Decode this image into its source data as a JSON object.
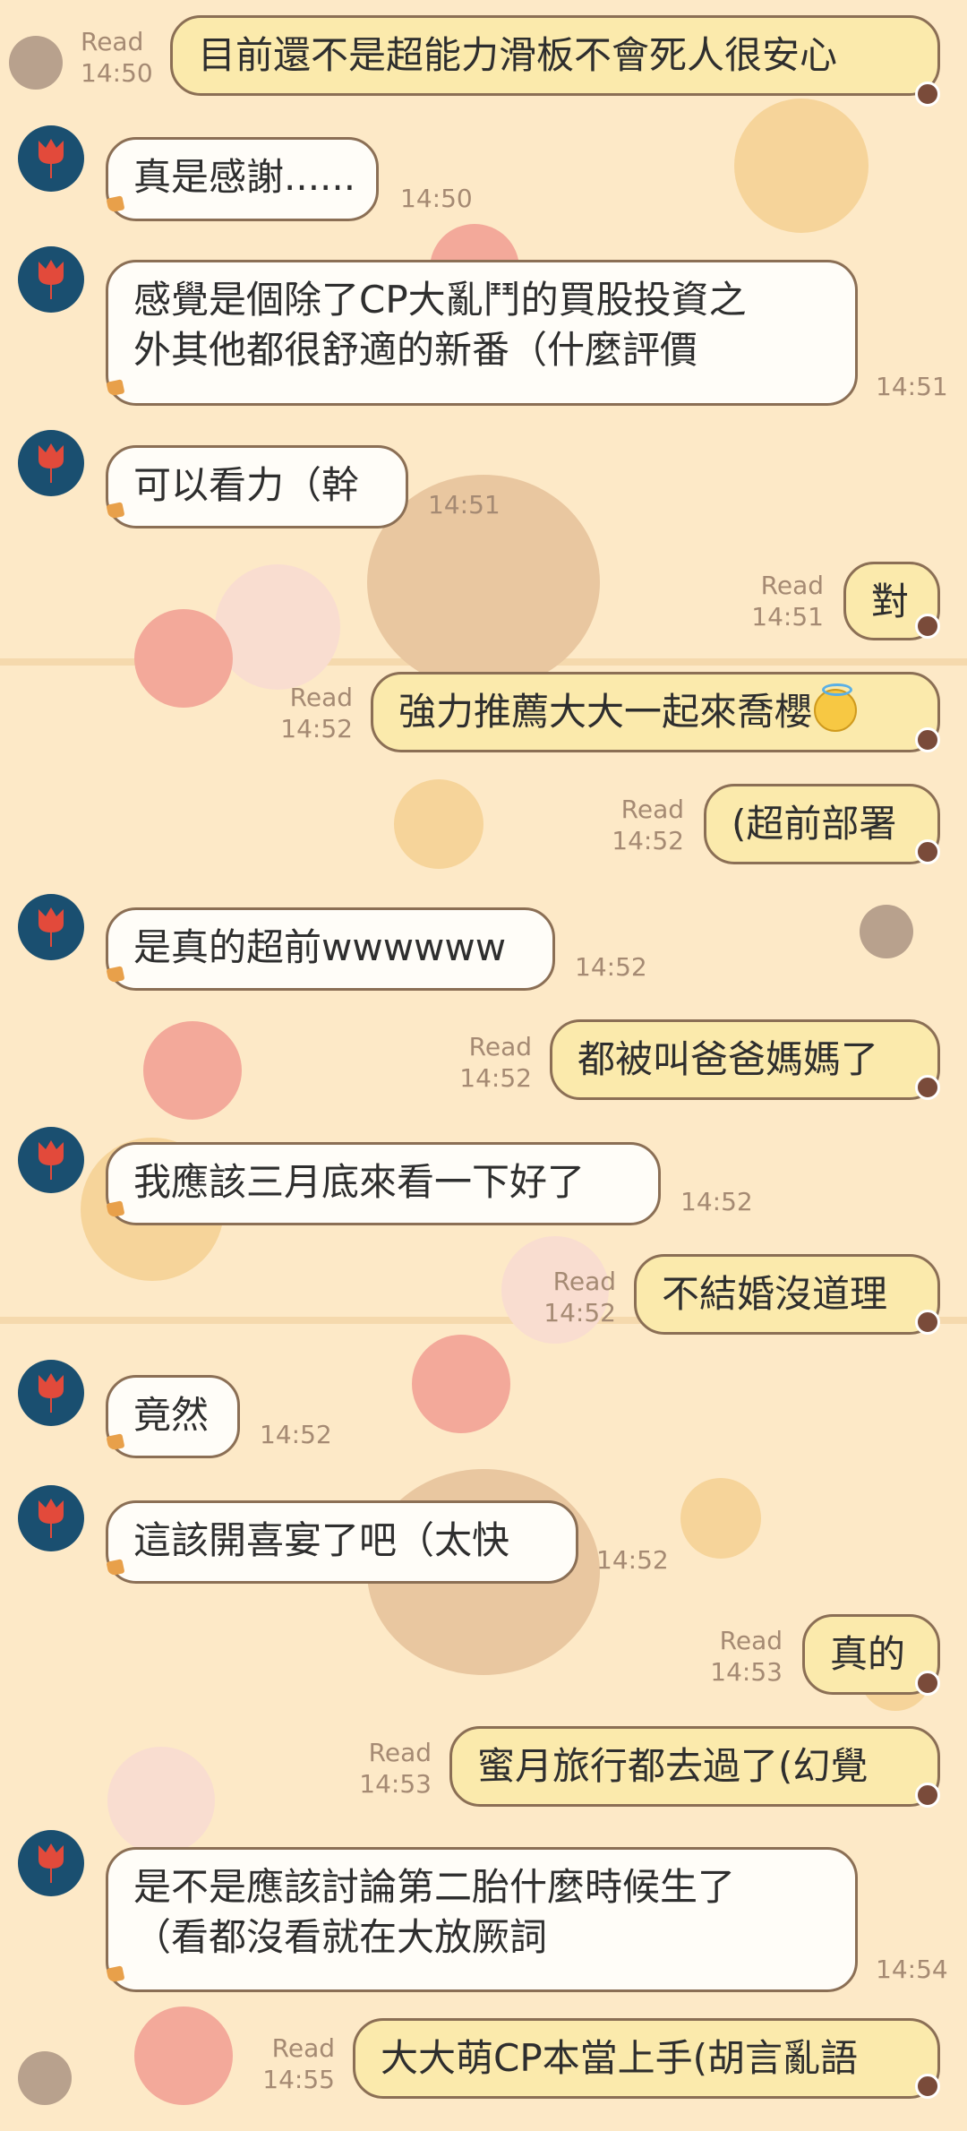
{
  "chat": {
    "messages": [
      {
        "side": "me",
        "text": "目前還不是超能力滑板不會死人很安心",
        "read": "Read",
        "time": "14:50"
      },
      {
        "side": "friend",
        "text": "真是感謝......",
        "time": "14:50"
      },
      {
        "side": "friend",
        "lines": [
          "感覺是個除了CP大亂鬥的買股投資之",
          "外其他都很舒適的新番（什麼評價"
        ],
        "time": "14:51"
      },
      {
        "side": "friend",
        "text": "可以看力（幹",
        "time": "14:51"
      },
      {
        "side": "me",
        "text": "對",
        "read": "Read",
        "time": "14:51"
      },
      {
        "side": "me",
        "text": "強力推薦大大一起來喬櫻",
        "emoji": "smiling-face-with-halo",
        "read": "Read",
        "time": "14:52"
      },
      {
        "side": "me",
        "text": "(超前部署",
        "read": "Read",
        "time": "14:52"
      },
      {
        "side": "friend",
        "text": "是真的超前wwwwww",
        "time": "14:52"
      },
      {
        "side": "me",
        "text": "都被叫爸爸媽媽了",
        "read": "Read",
        "time": "14:52"
      },
      {
        "side": "friend",
        "text": "我應該三月底來看一下好了",
        "time": "14:52"
      },
      {
        "side": "me",
        "text": "不結婚沒道理",
        "read": "Read",
        "time": "14:52"
      },
      {
        "side": "friend",
        "text": "竟然",
        "time": "14:52"
      },
      {
        "side": "friend",
        "text": "這該開喜宴了吧（太快",
        "time": "14:52"
      },
      {
        "side": "me",
        "text": "真的",
        "read": "Read",
        "time": "14:53"
      },
      {
        "side": "me",
        "text": "蜜月旅行都去過了(幻覺",
        "read": "Read",
        "time": "14:53"
      },
      {
        "side": "friend",
        "lines": [
          "是不是應該討論第二胎什麼時候生了",
          "（看都沒看就在大放厥詞"
        ],
        "time": "14:54"
      },
      {
        "side": "me",
        "text": "大大萌CP本當上手(胡言亂語",
        "read": "Read",
        "time": "14:55"
      }
    ]
  },
  "theme": {
    "background": "#fde9c7",
    "my_bubble": "#fbeaac",
    "friend_bubble": "#fffdf8",
    "bubble_border": "#8b6f55",
    "avatar_bg": "#1a4f70",
    "avatar_icon": "red-tulip-icon",
    "meta_color": "#a58a73"
  }
}
